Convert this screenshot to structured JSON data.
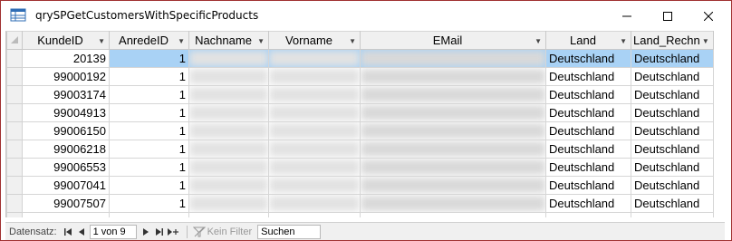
{
  "window": {
    "title": "qrySPGetCustomersWithSpecificProducts"
  },
  "columns": [
    {
      "label": "KundeID"
    },
    {
      "label": "AnredeID"
    },
    {
      "label": "Nachname"
    },
    {
      "label": "Vorname"
    },
    {
      "label": "EMail"
    },
    {
      "label": "Land"
    },
    {
      "label": "Land_Rechn"
    }
  ],
  "rows": [
    {
      "kundeid": "20139",
      "anredeid": "1",
      "land": "Deutschland",
      "land_rechn": "Deutschland"
    },
    {
      "kundeid": "99000192",
      "anredeid": "1",
      "land": "Deutschland",
      "land_rechn": "Deutschland"
    },
    {
      "kundeid": "99003174",
      "anredeid": "1",
      "land": "Deutschland",
      "land_rechn": "Deutschland"
    },
    {
      "kundeid": "99004913",
      "anredeid": "1",
      "land": "Deutschland",
      "land_rechn": "Deutschland"
    },
    {
      "kundeid": "99006150",
      "anredeid": "1",
      "land": "Deutschland",
      "land_rechn": "Deutschland"
    },
    {
      "kundeid": "99006218",
      "anredeid": "1",
      "land": "Deutschland",
      "land_rechn": "Deutschland"
    },
    {
      "kundeid": "99006553",
      "anredeid": "1",
      "land": "Deutschland",
      "land_rechn": "Deutschland"
    },
    {
      "kundeid": "99007041",
      "anredeid": "1",
      "land": "Deutschland",
      "land_rechn": "Deutschland"
    },
    {
      "kundeid": "99007507",
      "anredeid": "1",
      "land": "Deutschland",
      "land_rechn": "Deutschland"
    }
  ],
  "navigation": {
    "label": "Datensatz:",
    "position": "1 von 9",
    "filter_label": "Kein Filter",
    "search_value": "Suchen"
  },
  "colors": {
    "border": "#a03030",
    "selected_cell": "#a9d2f5",
    "header_bg": "#f0f0f0"
  }
}
